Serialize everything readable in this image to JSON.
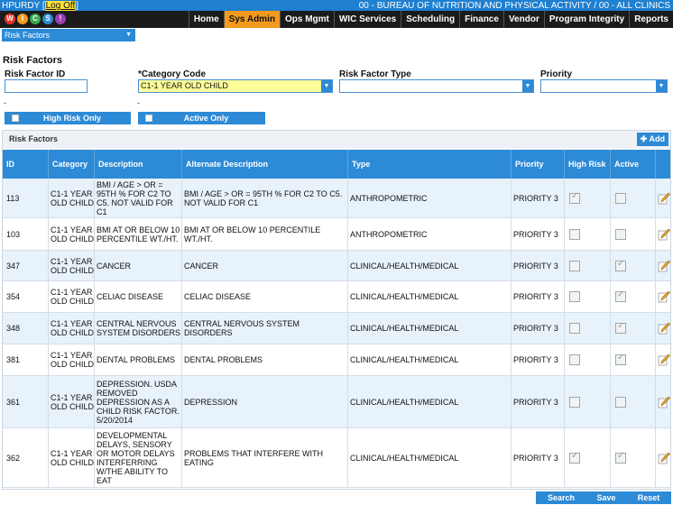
{
  "header": {
    "username": "HPURDY",
    "logoff_label": "Log Off",
    "bureau_text": "00 - BUREAU OF NUTRITION AND PHYSICAL ACTIVITY / 00 - ALL CLINICS",
    "logo_letters": [
      "W",
      "I",
      "C",
      "S",
      "!"
    ],
    "nav": [
      "Home",
      "Sys Admin",
      "Ops Mgmt",
      "WIC Services",
      "Scheduling",
      "Finance",
      "Vendor",
      "Program Integrity",
      "Reports"
    ],
    "active_nav": "Sys Admin"
  },
  "submenu": {
    "label": "Risk Factors"
  },
  "page": {
    "title": "Risk Factors"
  },
  "filters": {
    "risk_factor_id": {
      "label": "Risk Factor ID",
      "value": ""
    },
    "category_code": {
      "label": "*Category Code",
      "value": "C1-1 YEAR OLD CHILD"
    },
    "risk_factor_type": {
      "label": "Risk Factor Type",
      "value": ""
    },
    "priority": {
      "label": "Priority",
      "value": ""
    },
    "dash1": "-",
    "dash2": "-",
    "high_risk_only": "High Risk Only",
    "active_only": "Active Only"
  },
  "panel": {
    "title": "Risk Factors",
    "add_label": "Add"
  },
  "table": {
    "columns": [
      "ID",
      "Category",
      "Description",
      "Alternate Description",
      "Type",
      "Priority",
      "High Risk",
      "Active"
    ],
    "rows": [
      {
        "id": "113",
        "category": "C1-1 YEAR OLD CHILD",
        "description": "BMI / AGE > OR = 95TH % FOR C2 TO C5. NOT VALID FOR C1",
        "alt": "BMI / AGE > OR = 95TH % FOR C2 TO C5. NOT VALID FOR C1",
        "type": "ANTHROPOMETRIC",
        "priority": "PRIORITY 3",
        "high_risk": true,
        "active": false
      },
      {
        "id": "103",
        "category": "C1-1 YEAR OLD CHILD",
        "description": "BMI AT OR BELOW 10 PERCENTILE WT./HT.",
        "alt": "BMI AT OR BELOW 10 PERCENTILE WT./HT.",
        "type": "ANTHROPOMETRIC",
        "priority": "PRIORITY 3",
        "high_risk": false,
        "active": false
      },
      {
        "id": "347",
        "category": "C1-1 YEAR OLD CHILD",
        "description": "CANCER",
        "alt": "CANCER",
        "type": "CLINICAL/HEALTH/MEDICAL",
        "priority": "PRIORITY 3",
        "high_risk": false,
        "active": true
      },
      {
        "id": "354",
        "category": "C1-1 YEAR OLD CHILD",
        "description": "CELIAC DISEASE",
        "alt": "CELIAC DISEASE",
        "type": "CLINICAL/HEALTH/MEDICAL",
        "priority": "PRIORITY 3",
        "high_risk": false,
        "active": true
      },
      {
        "id": "348",
        "category": "C1-1 YEAR OLD CHILD",
        "description": "CENTRAL NERVOUS SYSTEM DISORDERS",
        "alt": "CENTRAL NERVOUS SYSTEM DISORDERS",
        "type": "CLINICAL/HEALTH/MEDICAL",
        "priority": "PRIORITY 3",
        "high_risk": false,
        "active": true
      },
      {
        "id": "381",
        "category": "C1-1 YEAR OLD CHILD",
        "description": "DENTAL PROBLEMS",
        "alt": "DENTAL PROBLEMS",
        "type": "CLINICAL/HEALTH/MEDICAL",
        "priority": "PRIORITY 3",
        "high_risk": false,
        "active": true
      },
      {
        "id": "361",
        "category": "C1-1 YEAR OLD CHILD",
        "description": "DEPRESSION. USDA REMOVED DEPRESSION AS A CHILD RISK FACTOR. 5/20/2014",
        "alt": "DEPRESSION",
        "type": "CLINICAL/HEALTH/MEDICAL",
        "priority": "PRIORITY 3",
        "high_risk": false,
        "active": false
      },
      {
        "id": "362",
        "category": "C1-1 YEAR OLD CHILD",
        "description": "DEVELOPMENTAL DELAYS, SENSORY OR MOTOR DELAYS INTERFERRING W/THE ABILITY TO EAT",
        "alt": "PROBLEMS THAT INTERFERE WITH EATING",
        "type": "CLINICAL/HEALTH/MEDICAL",
        "priority": "PRIORITY 3",
        "high_risk": true,
        "active": true
      }
    ]
  },
  "buttons": {
    "search": "Search",
    "save": "Save",
    "reset": "Reset"
  },
  "colors": {
    "accent": "#2c8ad6",
    "active_tab": "#f39a1e",
    "nav_bg": "#1b1b1b",
    "alt_row": "#e8f2fb",
    "required_field": "#ffff9a"
  }
}
